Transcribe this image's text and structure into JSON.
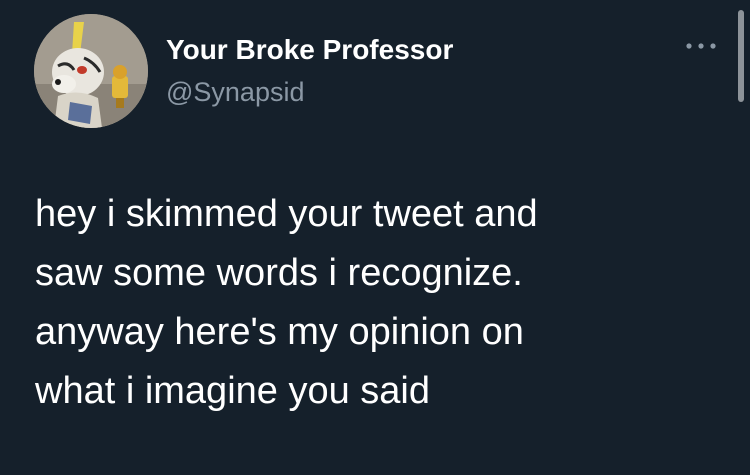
{
  "author": {
    "display_name": "Your Broke Professor",
    "handle": "@Synapsid",
    "avatar_icon": "character-avatar-icon"
  },
  "menu": {
    "more_icon": "more-options-icon"
  },
  "tweet": {
    "lines": [
      "hey i skimmed your tweet and",
      "saw some words i recognize.",
      "anyway here's my opinion on",
      "what i imagine you said"
    ]
  },
  "colors": {
    "background": "#15202b",
    "primary_text": "#ffffff",
    "secondary_text": "#8b98a5"
  }
}
